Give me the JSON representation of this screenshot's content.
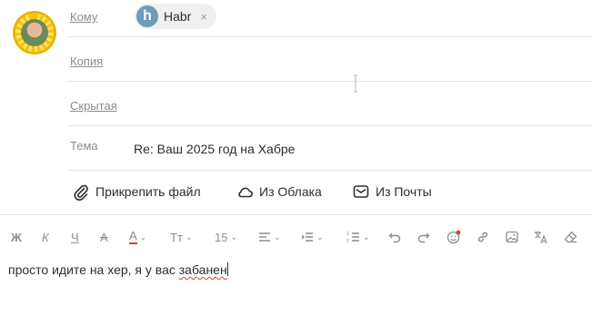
{
  "fields": {
    "to_label": "Кому",
    "cc_label": "Копия",
    "bcc_label": "Скрытая",
    "subject_label": "Тема",
    "subject_value": "Re: Ваш 2025 год на Хабре"
  },
  "recipient": {
    "initial": "h",
    "name": "Habr",
    "remove": "×"
  },
  "attachments": {
    "file": "Прикрепить файл",
    "cloud": "Из Облака",
    "mail": "Из Почты"
  },
  "toolbar": {
    "bold": "Ж",
    "italic": "К",
    "underline": "Ч",
    "strike": "А",
    "text_color": "А",
    "font_size_icon": "Тт",
    "font_size": "15"
  },
  "body": {
    "text_before": "просто идите на хер, я у вас ",
    "misspelled": "забанен"
  },
  "colors": {
    "accent_red": "#e53935",
    "chip_logo": "#6d9bb8"
  }
}
